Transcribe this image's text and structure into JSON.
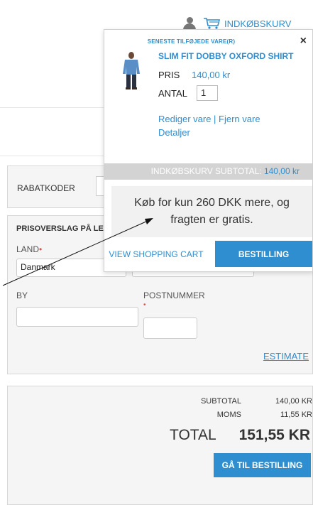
{
  "header": {
    "cart_label": "INDKØBSKURV"
  },
  "discount": {
    "label": "RABATKODER"
  },
  "estimate": {
    "title": "PRISOVERSLAG PÅ LEV",
    "country_label": "LAND",
    "country_value": "Danmark",
    "city_label": "BY",
    "zip_label": "POSTNUMMER",
    "estimate_link": "ESTIMATE"
  },
  "totals": {
    "subtotal_label": "SUBTOTAL",
    "subtotal_value": "140,00 KR",
    "tax_label": "MOMS",
    "tax_value": "11,55 KR",
    "total_label": "TOTAL",
    "total_value": "151,55 KR",
    "checkout_button": "GÅ TIL BESTILLING"
  },
  "minicart": {
    "heading": "SENESTE TILFØJEDE VARE(R)",
    "close_symbol": "×",
    "product_name": "SLIM FIT DOBBY OXFORD SHIRT",
    "price_label": "PRIS",
    "price_value": "140,00 kr",
    "qty_label": "ANTAL",
    "qty_value": "1",
    "edit_link": "Rediger vare",
    "separator": " | ",
    "remove_link": "Fjern vare",
    "details_link": "Detaljer",
    "subtotal_label": "INDKØBSKURV SUBTOTAL:",
    "subtotal_value": "140,00 kr",
    "shipping_line1": "Køb for kun 260 DKK mere, og",
    "shipping_line2": "fragten er gratis.",
    "view_cart_button": "VIEW SHOPPING CART",
    "order_button": "BESTILLING"
  },
  "colors": {
    "accent": "#2f8ecf",
    "panel": "#f5f5f5",
    "subtotal_bar": "#d3d3d3"
  }
}
